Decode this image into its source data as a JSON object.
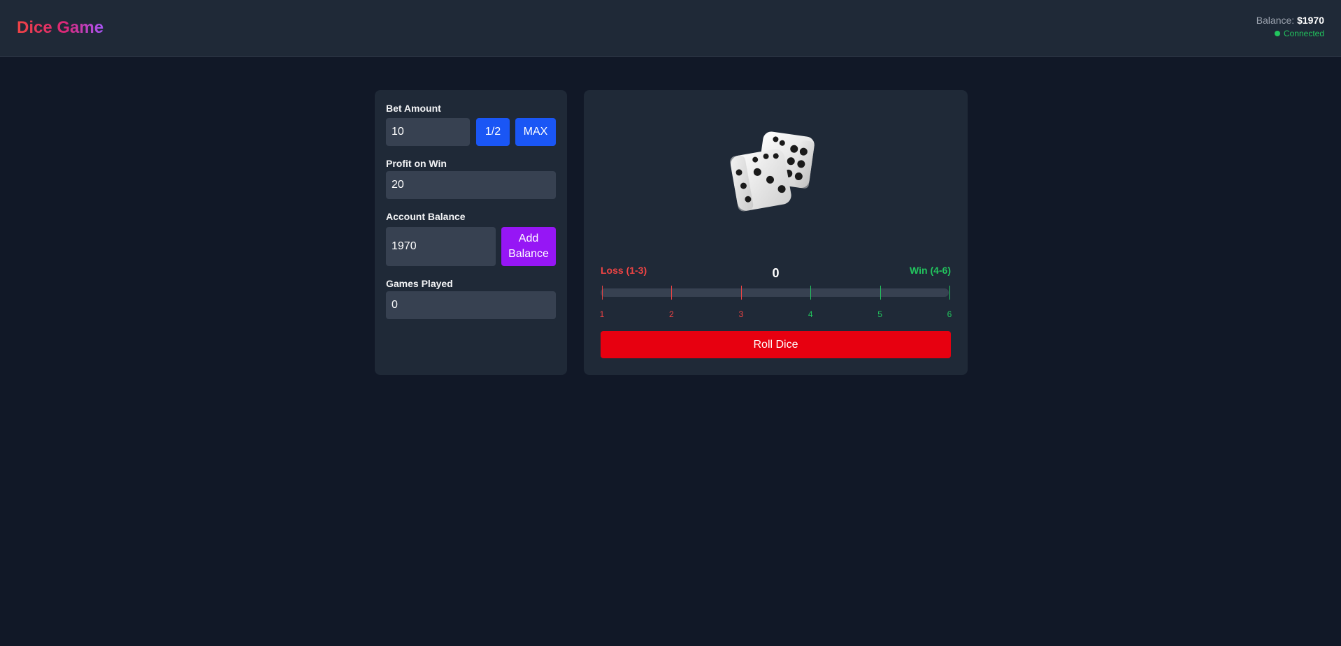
{
  "header": {
    "title": "Dice Game",
    "balance_label": "Balance:",
    "balance_value": "$1970",
    "status": "Connected"
  },
  "left_panel": {
    "bet_amount": {
      "label": "Bet Amount",
      "value": "10",
      "half_label": "1/2",
      "max_label": "MAX"
    },
    "profit": {
      "label": "Profit on Win",
      "value": "20"
    },
    "account": {
      "label": "Account Balance",
      "value": "1970",
      "add_line1": "Add",
      "add_line2": "Balance"
    },
    "games": {
      "label": "Games Played",
      "value": "0"
    }
  },
  "game": {
    "dice_icon": "two-dice-icon",
    "loss_label": "Loss (1-3)",
    "win_label": "Win (4-6)",
    "result": "0",
    "ticks": [
      "1",
      "2",
      "3",
      "4",
      "5",
      "6"
    ],
    "roll_label": "Roll Dice"
  },
  "colors": {
    "background": "#111827",
    "panel": "#1f2937",
    "input": "#374151",
    "loss": "#ef4444",
    "win": "#22c55e",
    "blue_button": "#1a56f5",
    "purple_button": "#9616f5",
    "roll_button": "#e70010"
  }
}
